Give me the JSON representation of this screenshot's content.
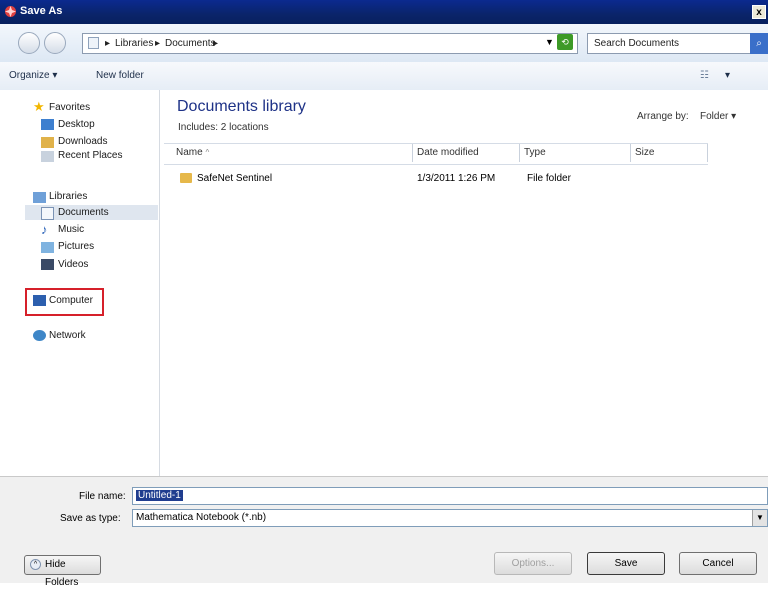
{
  "window": {
    "title": "Save As",
    "close_glyph": "x"
  },
  "address": {
    "crumbs": [
      "Libraries",
      "Documents"
    ],
    "separator": "▸",
    "search_placeholder": "Search Documents"
  },
  "toolbar": {
    "organize": "Organize",
    "new_folder": "New folder"
  },
  "nav": {
    "favorites": {
      "label": "Favorites",
      "items": [
        "Desktop",
        "Downloads",
        "Recent Places"
      ]
    },
    "libraries": {
      "label": "Libraries",
      "items": [
        "Documents",
        "Music",
        "Pictures",
        "Videos"
      ]
    },
    "computer": "Computer",
    "network": "Network"
  },
  "content": {
    "title": "Documents library",
    "includes": "Includes: 2 locations",
    "arrange_by_label": "Arrange by:",
    "arrange_by_value": "Folder",
    "columns": {
      "name": "Name",
      "date": "Date modified",
      "type": "Type",
      "size": "Size"
    },
    "rows": [
      {
        "name": "SafeNet Sentinel",
        "date": "1/3/2011 1:26 PM",
        "type": "File folder",
        "size": ""
      }
    ]
  },
  "form": {
    "file_name_label": "File name:",
    "file_name_value": "Untitled-1",
    "save_type_label": "Save as type:",
    "save_type_value": "Mathematica Notebook (*.nb)"
  },
  "buttons": {
    "hide_folders": "Hide Folders",
    "options": "Options...",
    "save": "Save",
    "cancel": "Cancel"
  }
}
